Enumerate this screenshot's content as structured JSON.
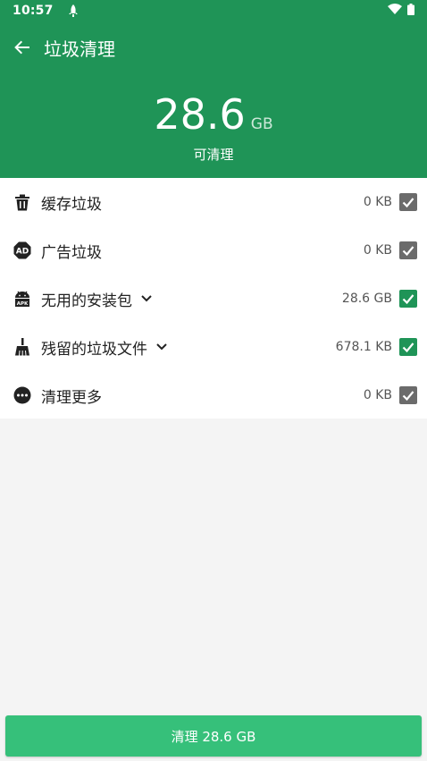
{
  "status_bar": {
    "time": "10:57"
  },
  "toolbar": {
    "title": "垃圾清理"
  },
  "summary": {
    "size_value": "28.6",
    "size_unit": "GB",
    "caption": "可清理"
  },
  "items": [
    {
      "label": "缓存垃圾",
      "size": "0 KB",
      "checked": true,
      "icon": "trash-icon"
    },
    {
      "label": "广告垃圾",
      "size": "0 KB",
      "checked": true,
      "icon": "ad-icon"
    },
    {
      "label": "无用的安装包",
      "size": "28.6 GB",
      "checked": true,
      "icon": "android-apk-icon"
    },
    {
      "label": "残留的垃圾文件",
      "size": "678.1 KB",
      "checked": true,
      "icon": "broom-icon"
    },
    {
      "label": "清理更多",
      "size": "0 KB",
      "checked": true,
      "icon": "more-icon"
    }
  ],
  "clean_button": {
    "label": "清理 28.6 GB"
  },
  "colors": {
    "primary": "#1f9457",
    "button": "#36c07a",
    "checkbox_grey": "#6b6b6b",
    "background": "#f4f4f4"
  }
}
